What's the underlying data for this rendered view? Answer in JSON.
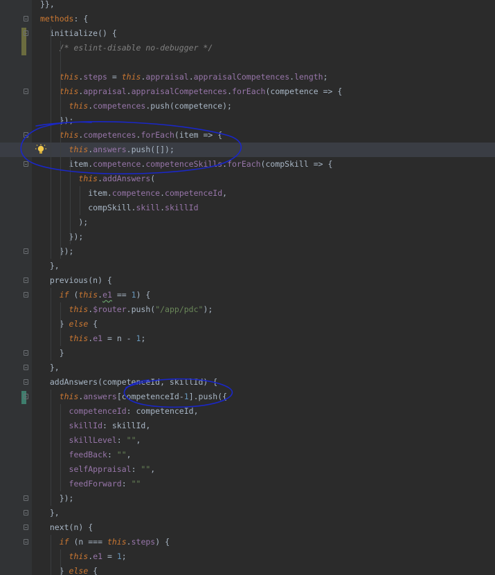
{
  "editor": {
    "lines": [
      {
        "n": "",
        "parts": [
          {
            "t": "}},",
            "c": "fn"
          }
        ]
      },
      {
        "n": "",
        "parts": [
          {
            "t": "methods",
            "c": "key"
          },
          {
            "t": ": {",
            "c": "fn"
          }
        ]
      },
      {
        "n": "",
        "parts": [
          {
            "t": "  initialize() {",
            "c": "fn"
          }
        ]
      },
      {
        "n": "",
        "parts": [
          {
            "t": "    ",
            "c": "fn"
          },
          {
            "t": "/* eslint-disable no-debugger */",
            "c": "cmt"
          }
        ]
      },
      {
        "n": "",
        "parts": []
      },
      {
        "n": "",
        "parts": [
          {
            "t": "    ",
            "c": "fn"
          },
          {
            "t": "this",
            "c": "kw"
          },
          {
            "t": ".",
            "c": "fn"
          },
          {
            "t": "steps",
            "c": "prop"
          },
          {
            "t": " = ",
            "c": "fn"
          },
          {
            "t": "this",
            "c": "kw"
          },
          {
            "t": ".",
            "c": "fn"
          },
          {
            "t": "appraisal",
            "c": "prop"
          },
          {
            "t": ".",
            "c": "fn"
          },
          {
            "t": "appraisalCompetences",
            "c": "prop"
          },
          {
            "t": ".",
            "c": "fn"
          },
          {
            "t": "length",
            "c": "prop"
          },
          {
            "t": ";",
            "c": "fn"
          }
        ]
      },
      {
        "n": "",
        "parts": [
          {
            "t": "    ",
            "c": "fn"
          },
          {
            "t": "this",
            "c": "kw"
          },
          {
            "t": ".",
            "c": "fn"
          },
          {
            "t": "appraisal",
            "c": "prop"
          },
          {
            "t": ".",
            "c": "fn"
          },
          {
            "t": "appraisalCompetences",
            "c": "prop"
          },
          {
            "t": ".",
            "c": "fn"
          },
          {
            "t": "forEach",
            "c": "prop"
          },
          {
            "t": "(competence => {",
            "c": "fn"
          }
        ]
      },
      {
        "n": "",
        "parts": [
          {
            "t": "      ",
            "c": "fn"
          },
          {
            "t": "this",
            "c": "kw"
          },
          {
            "t": ".",
            "c": "fn"
          },
          {
            "t": "competences",
            "c": "prop"
          },
          {
            "t": ".push(competence);",
            "c": "fn"
          }
        ]
      },
      {
        "n": "",
        "parts": [
          {
            "t": "    });",
            "c": "fn"
          }
        ]
      },
      {
        "n": "",
        "parts": [
          {
            "t": "    ",
            "c": "fn"
          },
          {
            "t": "this",
            "c": "kw"
          },
          {
            "t": ".",
            "c": "fn"
          },
          {
            "t": "competences",
            "c": "prop"
          },
          {
            "t": ".",
            "c": "fn"
          },
          {
            "t": "forEach",
            "c": "prop"
          },
          {
            "t": "(item => {",
            "c": "fn"
          }
        ]
      },
      {
        "n": "",
        "parts": [
          {
            "t": "      ",
            "c": "fn"
          },
          {
            "t": "this",
            "c": "kw"
          },
          {
            "t": ".",
            "c": "fn"
          },
          {
            "t": "answers",
            "c": "prop"
          },
          {
            "t": ".push([]);",
            "c": "fn"
          }
        ]
      },
      {
        "n": "",
        "parts": [
          {
            "t": "      item.",
            "c": "fn"
          },
          {
            "t": "competence",
            "c": "prop"
          },
          {
            "t": ".",
            "c": "fn"
          },
          {
            "t": "competenceSkills",
            "c": "prop"
          },
          {
            "t": ".",
            "c": "fn"
          },
          {
            "t": "forEach",
            "c": "prop"
          },
          {
            "t": "(compSkill => {",
            "c": "fn"
          }
        ]
      },
      {
        "n": "",
        "parts": [
          {
            "t": "        ",
            "c": "fn"
          },
          {
            "t": "this",
            "c": "kw"
          },
          {
            "t": ".",
            "c": "fn"
          },
          {
            "t": "addAnswers",
            "c": "prop"
          },
          {
            "t": "(",
            "c": "fn"
          }
        ]
      },
      {
        "n": "",
        "parts": [
          {
            "t": "          item.",
            "c": "fn"
          },
          {
            "t": "competence",
            "c": "prop"
          },
          {
            "t": ".",
            "c": "fn"
          },
          {
            "t": "competenceId",
            "c": "prop"
          },
          {
            "t": ",",
            "c": "fn"
          }
        ]
      },
      {
        "n": "",
        "parts": [
          {
            "t": "          compSkill.",
            "c": "fn"
          },
          {
            "t": "skill",
            "c": "prop"
          },
          {
            "t": ".",
            "c": "fn"
          },
          {
            "t": "skillId",
            "c": "prop"
          }
        ]
      },
      {
        "n": "",
        "parts": [
          {
            "t": "        );",
            "c": "fn"
          }
        ]
      },
      {
        "n": "",
        "parts": [
          {
            "t": "      });",
            "c": "fn"
          }
        ]
      },
      {
        "n": "",
        "parts": [
          {
            "t": "    });",
            "c": "fn"
          }
        ]
      },
      {
        "n": "",
        "parts": [
          {
            "t": "  },",
            "c": "fn"
          }
        ]
      },
      {
        "n": "",
        "parts": [
          {
            "t": "  previous(n) {",
            "c": "fn"
          }
        ]
      },
      {
        "n": "",
        "parts": [
          {
            "t": "    ",
            "c": "fn"
          },
          {
            "t": "if",
            "c": "kw"
          },
          {
            "t": " (",
            "c": "fn"
          },
          {
            "t": "this",
            "c": "kw"
          },
          {
            "t": ".",
            "c": "fn"
          },
          {
            "t": "e1",
            "c": "prop wavy"
          },
          {
            "t": " == ",
            "c": "fn"
          },
          {
            "t": "1",
            "c": "num"
          },
          {
            "t": ") {",
            "c": "fn"
          }
        ]
      },
      {
        "n": "",
        "parts": [
          {
            "t": "      ",
            "c": "fn"
          },
          {
            "t": "this",
            "c": "kw"
          },
          {
            "t": ".",
            "c": "fn"
          },
          {
            "t": "$router",
            "c": "prop"
          },
          {
            "t": ".push(",
            "c": "fn"
          },
          {
            "t": "\"/app/pdc\"",
            "c": "str"
          },
          {
            "t": ");",
            "c": "fn"
          }
        ]
      },
      {
        "n": "",
        "parts": [
          {
            "t": "    } ",
            "c": "fn"
          },
          {
            "t": "else",
            "c": "kw"
          },
          {
            "t": " {",
            "c": "fn"
          }
        ]
      },
      {
        "n": "",
        "parts": [
          {
            "t": "      ",
            "c": "fn"
          },
          {
            "t": "this",
            "c": "kw"
          },
          {
            "t": ".",
            "c": "fn"
          },
          {
            "t": "e1",
            "c": "prop"
          },
          {
            "t": " = n - ",
            "c": "fn"
          },
          {
            "t": "1",
            "c": "num"
          },
          {
            "t": ";",
            "c": "fn"
          }
        ]
      },
      {
        "n": "",
        "parts": [
          {
            "t": "    }",
            "c": "fn"
          }
        ]
      },
      {
        "n": "",
        "parts": [
          {
            "t": "  },",
            "c": "fn"
          }
        ]
      },
      {
        "n": "",
        "parts": [
          {
            "t": "  addAnswers(competenceId, skillId) {",
            "c": "fn"
          }
        ]
      },
      {
        "n": "",
        "parts": [
          {
            "t": "    ",
            "c": "fn"
          },
          {
            "t": "this",
            "c": "kw"
          },
          {
            "t": ".",
            "c": "fn"
          },
          {
            "t": "answers",
            "c": "prop"
          },
          {
            "t": "[competenceId-",
            "c": "fn"
          },
          {
            "t": "1",
            "c": "num"
          },
          {
            "t": "].push({",
            "c": "fn"
          }
        ]
      },
      {
        "n": "",
        "parts": [
          {
            "t": "      ",
            "c": "fn"
          },
          {
            "t": "competenceId",
            "c": "prop"
          },
          {
            "t": ": competenceId,",
            "c": "fn"
          }
        ]
      },
      {
        "n": "",
        "parts": [
          {
            "t": "      ",
            "c": "fn"
          },
          {
            "t": "skillId",
            "c": "prop"
          },
          {
            "t": ": skillId,",
            "c": "fn"
          }
        ]
      },
      {
        "n": "",
        "parts": [
          {
            "t": "      ",
            "c": "fn"
          },
          {
            "t": "skillLevel",
            "c": "prop"
          },
          {
            "t": ": ",
            "c": "fn"
          },
          {
            "t": "\"\"",
            "c": "str"
          },
          {
            "t": ",",
            "c": "fn"
          }
        ]
      },
      {
        "n": "",
        "parts": [
          {
            "t": "      ",
            "c": "fn"
          },
          {
            "t": "feedBack",
            "c": "prop"
          },
          {
            "t": ": ",
            "c": "fn"
          },
          {
            "t": "\"\"",
            "c": "str"
          },
          {
            "t": ",",
            "c": "fn"
          }
        ]
      },
      {
        "n": "",
        "parts": [
          {
            "t": "      ",
            "c": "fn"
          },
          {
            "t": "selfAppraisal",
            "c": "prop"
          },
          {
            "t": ": ",
            "c": "fn"
          },
          {
            "t": "\"\"",
            "c": "str"
          },
          {
            "t": ",",
            "c": "fn"
          }
        ]
      },
      {
        "n": "",
        "parts": [
          {
            "t": "      ",
            "c": "fn"
          },
          {
            "t": "feedForward",
            "c": "prop"
          },
          {
            "t": ": ",
            "c": "fn"
          },
          {
            "t": "\"\"",
            "c": "str"
          }
        ]
      },
      {
        "n": "",
        "parts": [
          {
            "t": "    });",
            "c": "fn"
          }
        ]
      },
      {
        "n": "",
        "parts": [
          {
            "t": "  },",
            "c": "fn"
          }
        ]
      },
      {
        "n": "",
        "parts": [
          {
            "t": "  next(n) {",
            "c": "fn"
          }
        ]
      },
      {
        "n": "",
        "parts": [
          {
            "t": "    ",
            "c": "fn"
          },
          {
            "t": "if",
            "c": "kw"
          },
          {
            "t": " (n === ",
            "c": "fn"
          },
          {
            "t": "this",
            "c": "kw"
          },
          {
            "t": ".",
            "c": "fn"
          },
          {
            "t": "steps",
            "c": "prop"
          },
          {
            "t": ") {",
            "c": "fn"
          }
        ]
      },
      {
        "n": "",
        "parts": [
          {
            "t": "      ",
            "c": "fn"
          },
          {
            "t": "this",
            "c": "kw"
          },
          {
            "t": ".",
            "c": "fn"
          },
          {
            "t": "e1",
            "c": "prop"
          },
          {
            "t": " = ",
            "c": "fn"
          },
          {
            "t": "1",
            "c": "num"
          },
          {
            "t": ";",
            "c": "fn"
          }
        ]
      },
      {
        "n": "",
        "parts": [
          {
            "t": "    } ",
            "c": "fn"
          },
          {
            "t": "else",
            "c": "kw"
          },
          {
            "t": " {",
            "c": "fn"
          }
        ]
      }
    ],
    "current_line_index": 10,
    "colors": {
      "background": "#2b2b2b",
      "gutter": "#313335",
      "keyword": "#cc7832",
      "property": "#9876aa",
      "string": "#6a8759",
      "number": "#6897bb",
      "comment": "#808080",
      "annotation_ink": "#1a27c9"
    },
    "icons": [
      "lightbulb-icon",
      "fold-marker-icon"
    ]
  }
}
